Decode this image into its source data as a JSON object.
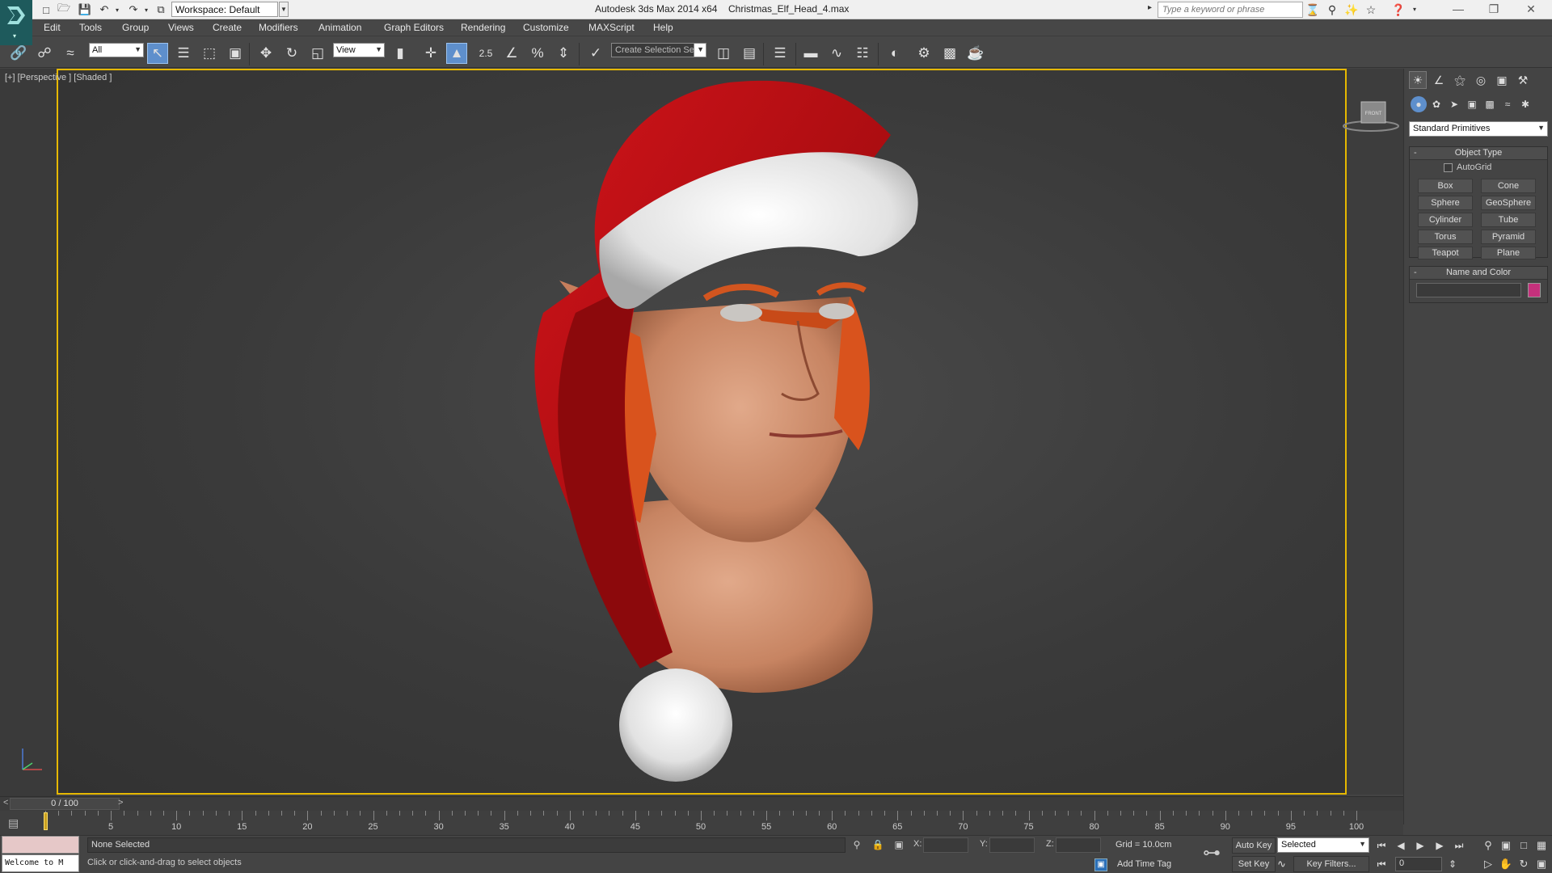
{
  "titlebar": {
    "workspace": "Workspace: Default",
    "app_title": "Autodesk 3ds Max  2014 x64",
    "file_name": "Christmas_Elf_Head_4.max",
    "search_placeholder": "Type a keyword or phrase"
  },
  "menu": [
    "Edit",
    "Tools",
    "Group",
    "Views",
    "Create",
    "Modifiers",
    "Animation",
    "Graph Editors",
    "Rendering",
    "Customize",
    "MAXScript",
    "Help"
  ],
  "toolbar": {
    "filter_value": "All",
    "refcoord_value": "View",
    "snap_label": "2.5",
    "selection_set_placeholder": "Create Selection Se"
  },
  "viewport": {
    "label": "[+] [Perspective ] [Shaded ]",
    "viewcube_face": "FRONT"
  },
  "command_panel": {
    "category": "Standard Primitives",
    "object_type_title": "Object Type",
    "autogrid_label": "AutoGrid",
    "primitives": [
      "Box",
      "Cone",
      "Sphere",
      "GeoSphere",
      "Cylinder",
      "Tube",
      "Torus",
      "Pyramid",
      "Teapot",
      "Plane"
    ],
    "name_color_title": "Name and Color",
    "object_color": "#c4317c"
  },
  "timeslider": {
    "position": "0 / 100",
    "left_arrow": "<",
    "right_arrow": ">"
  },
  "trackbar": {
    "labels": [
      "5",
      "10",
      "15",
      "20",
      "25",
      "30",
      "35",
      "40",
      "45",
      "50",
      "55",
      "60",
      "65",
      "70",
      "75",
      "80",
      "85",
      "90",
      "95",
      "100"
    ]
  },
  "status": {
    "maxscript_text": "Welcome to M",
    "selection": "None Selected",
    "prompt": "Click or click-and-drag to select objects",
    "x_label": "X:",
    "y_label": "Y:",
    "z_label": "Z:",
    "grid": "Grid = 10.0cm",
    "add_time_tag": "Add Time Tag",
    "auto_key": "Auto Key",
    "set_key": "Set Key",
    "key_mode": "Selected",
    "key_filters": "Key Filters...",
    "frame": "0"
  },
  "colors": {
    "viewport_border": "#e6b800",
    "active_tool": "#5e8fcc"
  }
}
